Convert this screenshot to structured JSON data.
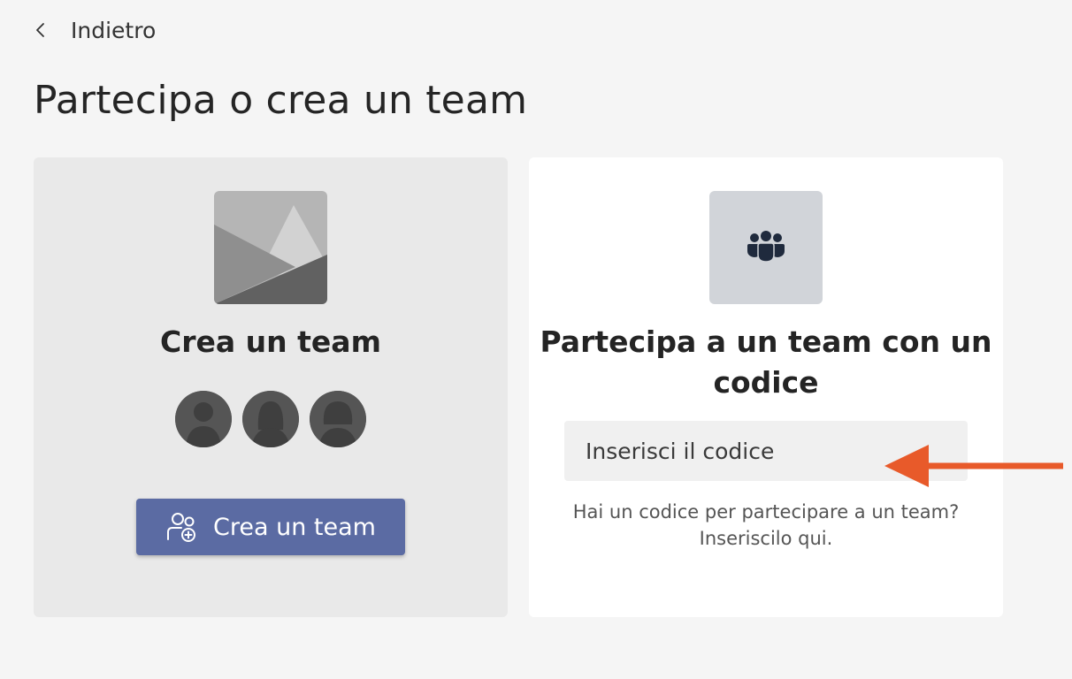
{
  "nav": {
    "back_label": "Indietro"
  },
  "page": {
    "title": "Partecipa o crea un team"
  },
  "create_card": {
    "title": "Crea un team",
    "button_label": "Crea un team",
    "button_icon": "people-add-icon"
  },
  "join_card": {
    "icon": "people-team-icon",
    "title_line1": "Partecipa a un team con un",
    "title_line2": "codice",
    "input": {
      "placeholder": "Inserisci il codice",
      "value": ""
    },
    "hint_line1": "Hai un codice per partecipare a un team?",
    "hint_line2": "Inseriscilo qui."
  },
  "colors": {
    "background": "#f5f5f5",
    "create_card_bg": "#e9e9e9",
    "join_card_bg": "#ffffff",
    "accent_button": "#5b6ba3",
    "annotation_arrow": "#e85a2a"
  }
}
